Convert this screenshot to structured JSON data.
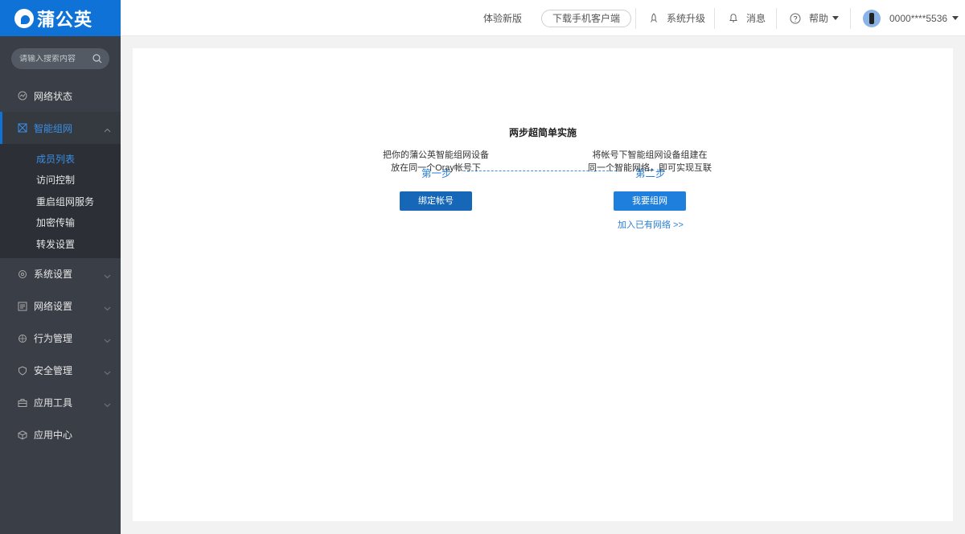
{
  "brand": {
    "name": "蒲公英"
  },
  "search": {
    "placeholder": "请输入搜索内容"
  },
  "sidebar": {
    "items": [
      {
        "label": "网络状态"
      },
      {
        "label": "智能组网"
      },
      {
        "label": "系统设置"
      },
      {
        "label": "网络设置"
      },
      {
        "label": "行为管理"
      },
      {
        "label": "安全管理"
      },
      {
        "label": "应用工具"
      },
      {
        "label": "应用中心"
      }
    ],
    "subitems": [
      {
        "label": "成员列表"
      },
      {
        "label": "访问控制"
      },
      {
        "label": "重启组网服务"
      },
      {
        "label": "加密传输"
      },
      {
        "label": "转发设置"
      }
    ]
  },
  "header": {
    "try_new": "体验新版",
    "download": "下载手机客户端",
    "upgrade": "系统升级",
    "messages": "消息",
    "help": "帮助",
    "account": "0000****5536"
  },
  "main": {
    "title": "两步超简单实施",
    "step1": {
      "label": "第一步",
      "desc_line1": "把你的蒲公英智能组网设备",
      "desc_line2": "放在同一个Oray帐号下",
      "button": "绑定帐号"
    },
    "step2": {
      "label": "第二步",
      "desc_line1": "将帐号下智能组网设备组建在",
      "desc_line2": "同一个智能网络，即可实现互联",
      "button": "我要组网",
      "link": "加入已有网络 >>"
    }
  },
  "colors": {
    "brand": "#0f72d6",
    "sidebar": "#3a3f47",
    "accent": "#2a7fd4"
  },
  "icons": [
    "search-icon",
    "network-status-icon",
    "smart-network-icon",
    "chevron-up-icon",
    "chevron-down-icon",
    "settings-icon",
    "network-settings-icon",
    "behavior-icon",
    "security-icon",
    "tools-icon",
    "app-center-icon",
    "upgrade-icon",
    "bell-icon",
    "help-icon",
    "caret-down-icon"
  ]
}
